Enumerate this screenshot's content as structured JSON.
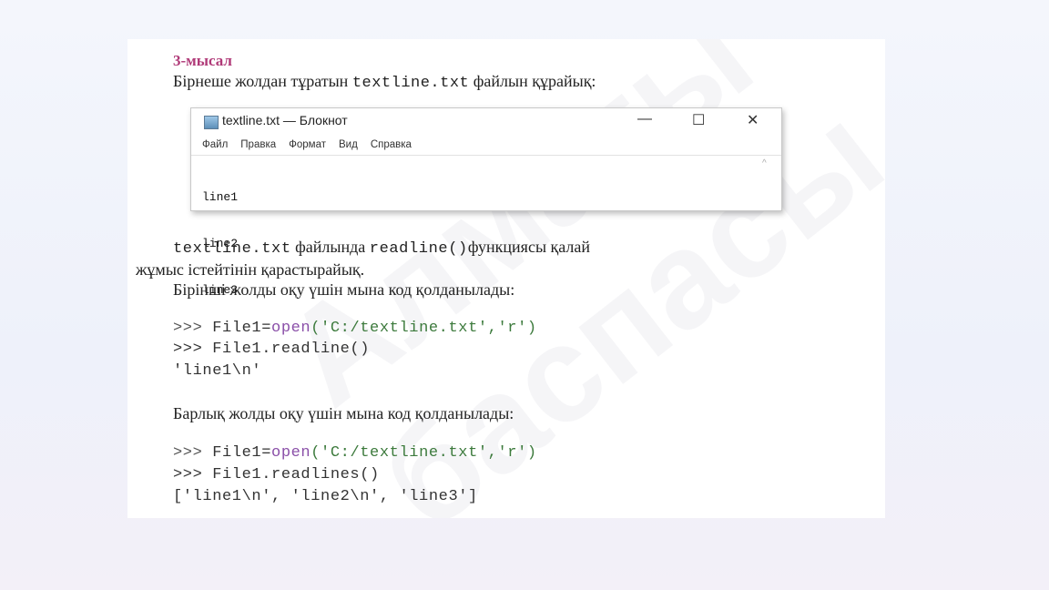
{
  "example": {
    "heading": "3-мысал",
    "intro_before": "Бірнеше жолдан тұратын ",
    "intro_code": "textline.txt",
    "intro_after": "  файлын құрайық:"
  },
  "notepad": {
    "title": "textline.txt — Блокнот",
    "icon": "notepad-icon",
    "controls": {
      "minimize": "—",
      "maximize": "☐",
      "close": "✕"
    },
    "menu": [
      "Файл",
      "Правка",
      "Формат",
      "Вид",
      "Справка"
    ],
    "lines": [
      "line1",
      "line2",
      "line3"
    ],
    "scroll_up": "^"
  },
  "text": {
    "para1_code1": "textline.txt",
    "para1_mid": "  файлында  ",
    "para1_code2": "readline()",
    "para1_after": "функциясы   қалай",
    "para1_line2": "жұмыс істейтінін қарастырайық.",
    "para2": "Бірінші жолды оқу үшін мына код қолданылады:",
    "para3": "Барлық жолды оқу үшін мына код қолданылады:"
  },
  "code1": {
    "l1_prompt": ">>> ",
    "l1_var": "File1=",
    "l1_fn": "open",
    "l1_args": "('C:/textline.txt','r')",
    "l2": ">>> File1.readline()",
    "l3": "'line1\\n'"
  },
  "code2": {
    "l1_prompt": ">>> ",
    "l1_var": "File1=",
    "l1_fn": "open",
    "l1_args": "('C:/textline.txt','r')",
    "l2": ">>> File1.readlines()",
    "l3": "['line1\\n', 'line2\\n', 'line3']"
  },
  "watermark": "Алматы баспасы"
}
